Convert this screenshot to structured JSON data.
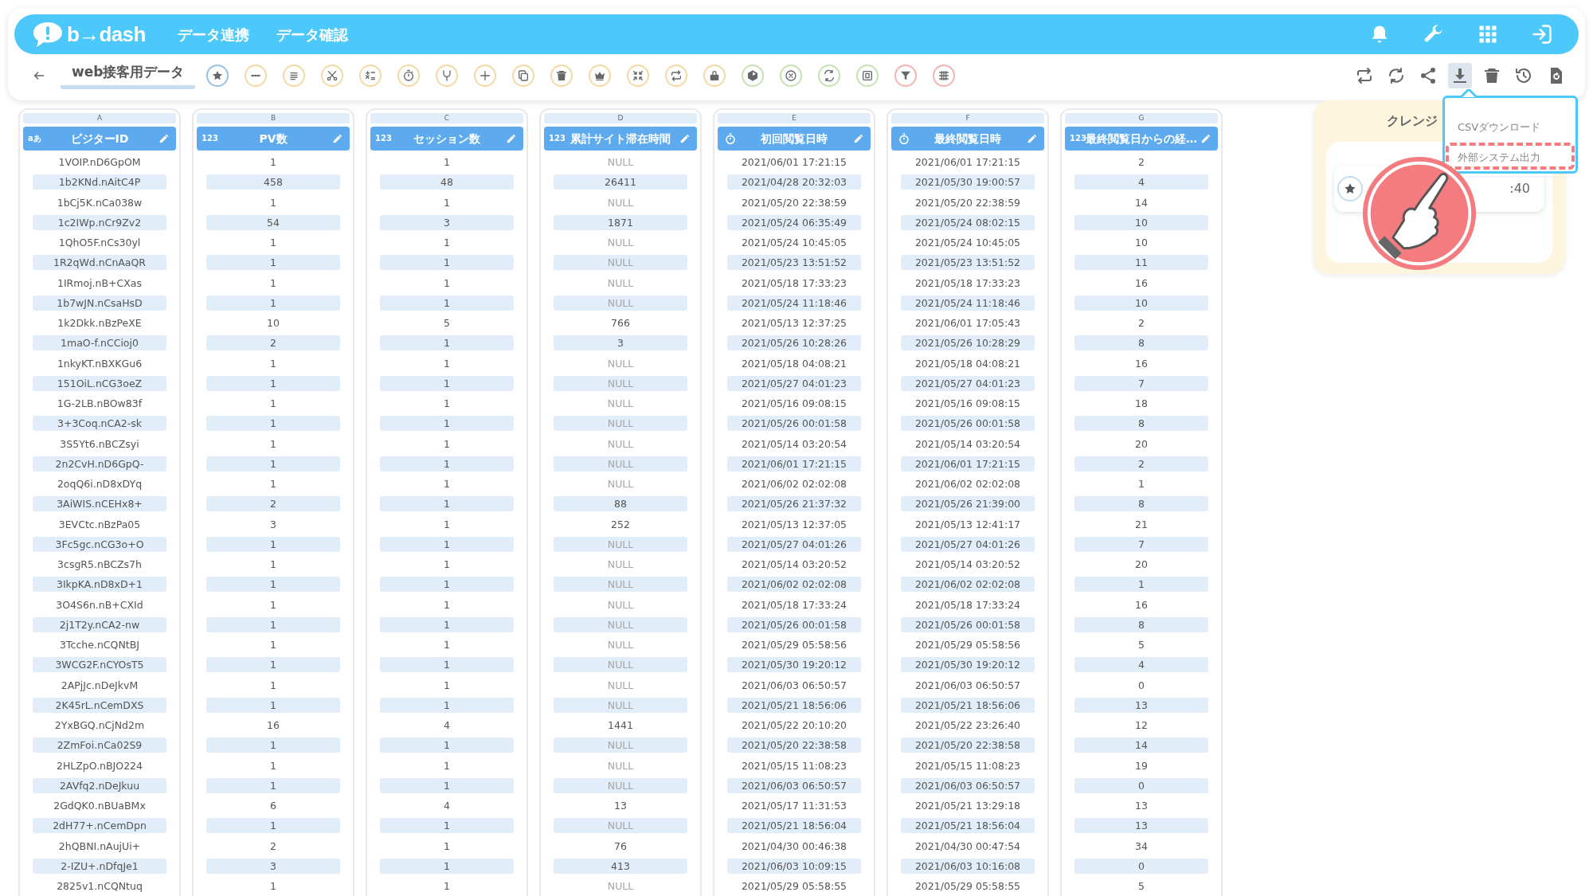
{
  "app_bar": {
    "logo": "b→dash",
    "nav": [
      {
        "label": "データ連携"
      },
      {
        "label": "データ確認"
      }
    ],
    "actions": [
      {
        "kind": "bell"
      },
      {
        "kind": "wrench"
      },
      {
        "kind": "apps"
      },
      {
        "kind": "logout"
      }
    ]
  },
  "toolbar": {
    "tab": {
      "label": "web接客用データ",
      "selected": true
    },
    "left_tools": [
      {
        "kind": "star",
        "color": "#9cc3e6"
      },
      {
        "kind": "dots",
        "color": "#f3d9a4"
      },
      {
        "kind": "list",
        "color": "#f3d9a4"
      },
      {
        "kind": "tools",
        "color": "#f3d9a4"
      },
      {
        "kind": "calc",
        "color": "#f3d9a4"
      },
      {
        "kind": "timer",
        "color": "#f3d9a4"
      },
      {
        "kind": "fork",
        "color": "#f3d9a4"
      },
      {
        "kind": "plus",
        "color": "#f3d9a4"
      },
      {
        "kind": "copy",
        "color": "#f3d9a4"
      },
      {
        "kind": "trash",
        "color": "#f3d9a4"
      },
      {
        "kind": "crown",
        "color": "#f3d9a4"
      },
      {
        "kind": "shrink",
        "color": "#f3d9a4"
      },
      {
        "kind": "repeat",
        "color": "#f3d9a4"
      },
      {
        "kind": "lock",
        "color": "#f3d9a4"
      },
      {
        "kind": "box",
        "color": "#c9e2b3"
      },
      {
        "kind": "xcircle",
        "color": "#c9e2b3"
      },
      {
        "kind": "swap",
        "color": "#c9e2b3"
      },
      {
        "kind": "square",
        "color": "#c9e2b3"
      },
      {
        "kind": "filter",
        "color": "#f5b3b3"
      },
      {
        "kind": "grid",
        "color": "#f5b3b3"
      }
    ],
    "right_tools": [
      {
        "kind": "repeat",
        "selected": false
      },
      {
        "kind": "sync",
        "selected": false
      },
      {
        "kind": "share",
        "selected": false
      },
      {
        "kind": "download",
        "selected": true
      },
      {
        "kind": "trash",
        "selected": false
      },
      {
        "kind": "history",
        "selected": false
      },
      {
        "kind": "file",
        "selected": false
      }
    ]
  },
  "table": {
    "columns": [
      {
        "letter": "A",
        "kind": "text",
        "badge": "aあ",
        "name": "ビジターID"
      },
      {
        "letter": "B",
        "kind": "number",
        "badge": "123",
        "name": "PV数"
      },
      {
        "letter": "C",
        "kind": "number",
        "badge": "123",
        "name": "セッション数"
      },
      {
        "letter": "D",
        "kind": "number",
        "badge": "123",
        "name": "累計サイト滞在時間"
      },
      {
        "letter": "E",
        "kind": "datetime",
        "name": "初回閲覧日時"
      },
      {
        "letter": "F",
        "kind": "datetime",
        "name": "最終閲覧日時"
      },
      {
        "letter": "G",
        "kind": "number",
        "badge": "123",
        "name": "最終閲覧日からの経…"
      }
    ],
    "rows": [
      {
        "cells": [
          "1VOIP.nD6GpOM",
          "1",
          "1",
          "NULL",
          "2021/06/01 17:21:15",
          "2021/06/01 17:21:15",
          "2"
        ],
        "d_null": true
      },
      {
        "cells": [
          "1b2KNd.nAitC4P",
          "458",
          "48",
          "26411",
          "2021/04/28 20:32:03",
          "2021/05/30 19:00:57",
          "4"
        ],
        "d_null": false
      },
      {
        "cells": [
          "1bCj5K.nCa038w",
          "1",
          "1",
          "NULL",
          "2021/05/20 22:38:59",
          "2021/05/20 22:38:59",
          "14"
        ],
        "d_null": true
      },
      {
        "cells": [
          "1c2IWp.nCr9Zv2",
          "54",
          "3",
          "1871",
          "2021/05/24 06:35:49",
          "2021/05/24 08:02:15",
          "10"
        ],
        "d_null": false
      },
      {
        "cells": [
          "1QhO5F.nCs30yl",
          "1",
          "1",
          "NULL",
          "2021/05/24 10:45:05",
          "2021/05/24 10:45:05",
          "10"
        ],
        "d_null": true
      },
      {
        "cells": [
          "1R2qWd.nCnAaQR",
          "1",
          "1",
          "NULL",
          "2021/05/23 13:51:52",
          "2021/05/23 13:51:52",
          "11"
        ],
        "d_null": true
      },
      {
        "cells": [
          "1IRmoj.nB+CXas",
          "1",
          "1",
          "NULL",
          "2021/05/18 17:33:23",
          "2021/05/18 17:33:23",
          "16"
        ],
        "d_null": true
      },
      {
        "cells": [
          "1b7wJN.nCsaHsD",
          "1",
          "1",
          "NULL",
          "2021/05/24 11:18:46",
          "2021/05/24 11:18:46",
          "10"
        ],
        "d_null": true
      },
      {
        "cells": [
          "1k2Dkk.nBzPeXE",
          "10",
          "5",
          "766",
          "2021/05/13 12:37:25",
          "2021/06/01 17:05:43",
          "2"
        ],
        "d_null": false
      },
      {
        "cells": [
          "1maO-f.nCCioj0",
          "2",
          "1",
          "3",
          "2021/05/26 10:28:26",
          "2021/05/26 10:28:29",
          "8"
        ],
        "d_null": false
      },
      {
        "cells": [
          "1nkyKT.nBXKGu6",
          "1",
          "1",
          "NULL",
          "2021/05/18 04:08:21",
          "2021/05/18 04:08:21",
          "16"
        ],
        "d_null": true
      },
      {
        "cells": [
          "151OiL.nCG3oeZ",
          "1",
          "1",
          "NULL",
          "2021/05/27 04:01:23",
          "2021/05/27 04:01:23",
          "7"
        ],
        "d_null": true
      },
      {
        "cells": [
          "1G-2LB.nBOw83f",
          "1",
          "1",
          "NULL",
          "2021/05/16 09:08:15",
          "2021/05/16 09:08:15",
          "18"
        ],
        "d_null": true
      },
      {
        "cells": [
          "3+3Coq.nCA2-sk",
          "1",
          "1",
          "NULL",
          "2021/05/26 00:01:58",
          "2021/05/26 00:01:58",
          "8"
        ],
        "d_null": true
      },
      {
        "cells": [
          "3S5Yt6.nBCZsyi",
          "1",
          "1",
          "NULL",
          "2021/05/14 03:20:54",
          "2021/05/14 03:20:54",
          "20"
        ],
        "d_null": true
      },
      {
        "cells": [
          "2n2CvH.nD6GpQ-",
          "1",
          "1",
          "NULL",
          "2021/06/01 17:21:15",
          "2021/06/01 17:21:15",
          "2"
        ],
        "d_null": true
      },
      {
        "cells": [
          "2oqQ6i.nD8xDYq",
          "1",
          "1",
          "NULL",
          "2021/06/02 02:02:08",
          "2021/06/02 02:02:08",
          "1"
        ],
        "d_null": true
      },
      {
        "cells": [
          "3AiWIS.nCEHx8+",
          "2",
          "1",
          "88",
          "2021/05/26 21:37:32",
          "2021/05/26 21:39:00",
          "8"
        ],
        "d_null": false
      },
      {
        "cells": [
          "3EVCtc.nBzPa05",
          "3",
          "1",
          "252",
          "2021/05/13 12:37:05",
          "2021/05/13 12:41:17",
          "21"
        ],
        "d_null": false
      },
      {
        "cells": [
          "3Fc5gc.nCG3o+O",
          "1",
          "1",
          "NULL",
          "2021/05/27 04:01:26",
          "2021/05/27 04:01:26",
          "7"
        ],
        "d_null": true
      },
      {
        "cells": [
          "3csgR5.nBCZs7h",
          "1",
          "1",
          "NULL",
          "2021/05/14 03:20:52",
          "2021/05/14 03:20:52",
          "20"
        ],
        "d_null": true
      },
      {
        "cells": [
          "3IkpKA.nD8xD+1",
          "1",
          "1",
          "NULL",
          "2021/06/02 02:02:08",
          "2021/06/02 02:02:08",
          "1"
        ],
        "d_null": true
      },
      {
        "cells": [
          "3O4S6n.nB+CXId",
          "1",
          "1",
          "NULL",
          "2021/05/18 17:33:24",
          "2021/05/18 17:33:24",
          "16"
        ],
        "d_null": true
      },
      {
        "cells": [
          "2j1T2y.nCA2-nw",
          "1",
          "1",
          "NULL",
          "2021/05/26 00:01:58",
          "2021/05/26 00:01:58",
          "8"
        ],
        "d_null": true
      },
      {
        "cells": [
          "3Tcche.nCQNtBJ",
          "1",
          "1",
          "NULL",
          "2021/05/29 05:58:56",
          "2021/05/29 05:58:56",
          "5"
        ],
        "d_null": true
      },
      {
        "cells": [
          "3WCG2F.nCYOsT5",
          "1",
          "1",
          "NULL",
          "2021/05/30 19:20:12",
          "2021/05/30 19:20:12",
          "4"
        ],
        "d_null": true
      },
      {
        "cells": [
          "2APjJc.nDeJkvM",
          "1",
          "1",
          "NULL",
          "2021/06/03 06:50:57",
          "2021/06/03 06:50:57",
          "0"
        ],
        "d_null": true
      },
      {
        "cells": [
          "2K45rL.nCemDXS",
          "1",
          "1",
          "NULL",
          "2021/05/21 18:56:06",
          "2021/05/21 18:56:06",
          "13"
        ],
        "d_null": true
      },
      {
        "cells": [
          "2YxBGQ.nCjNd2m",
          "16",
          "4",
          "1441",
          "2021/05/22 20:10:20",
          "2021/05/22 23:26:40",
          "12"
        ],
        "d_null": false
      },
      {
        "cells": [
          "2ZmFoi.nCa02S9",
          "1",
          "1",
          "NULL",
          "2021/05/20 22:38:58",
          "2021/05/20 22:38:58",
          "14"
        ],
        "d_null": true
      },
      {
        "cells": [
          "2HLZpO.nBJO224",
          "1",
          "1",
          "NULL",
          "2021/05/15 11:08:23",
          "2021/05/15 11:08:23",
          "19"
        ],
        "d_null": true
      },
      {
        "cells": [
          "2AVfq2.nDeJkuu",
          "1",
          "1",
          "NULL",
          "2021/06/03 06:50:57",
          "2021/06/03 06:50:57",
          "0"
        ],
        "d_null": true
      },
      {
        "cells": [
          "2GdQK0.nBUaBMx",
          "6",
          "4",
          "13",
          "2021/05/17 11:31:53",
          "2021/05/21 13:29:18",
          "13"
        ],
        "d_null": false
      },
      {
        "cells": [
          "2dH77+.nCemDpn",
          "1",
          "1",
          "NULL",
          "2021/05/21 18:56:04",
          "2021/05/21 18:56:04",
          "13"
        ],
        "d_null": true
      },
      {
        "cells": [
          "2hQBNI.nAujUi+",
          "2",
          "1",
          "76",
          "2021/04/30 00:46:38",
          "2021/04/30 00:47:54",
          "34"
        ],
        "d_null": false
      },
      {
        "cells": [
          "2-IZU+.nDfqJe1",
          "3",
          "1",
          "413",
          "2021/06/03 10:09:15",
          "2021/06/03 10:16:08",
          "0"
        ],
        "d_null": false
      },
      {
        "cells": [
          "2825v1.nCQNtuq",
          "1",
          "1",
          "NULL",
          "2021/05/29 05:58:55",
          "2021/05/29 05:58:55",
          "5"
        ],
        "d_null": true
      }
    ]
  },
  "side_panel": {
    "title": "クレンジ",
    "card_text": ":40"
  },
  "download_menu": {
    "items": [
      {
        "label": "CSVダウンロード",
        "highlighted": false
      },
      {
        "label": "外部システム出力",
        "highlighted": true
      }
    ]
  }
}
